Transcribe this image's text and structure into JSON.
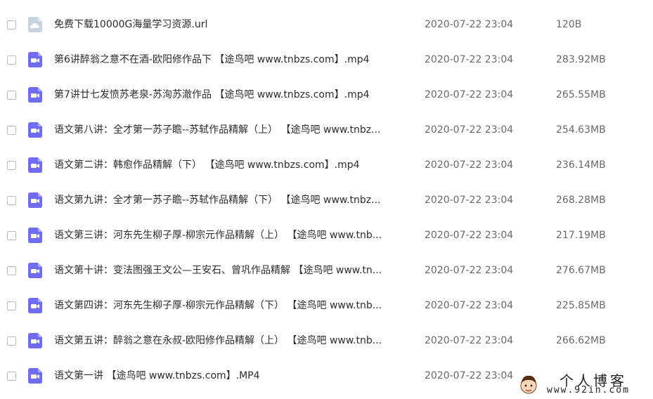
{
  "files": [
    {
      "type": "link",
      "icon": "url-file-icon",
      "name": "免费下载10000G海量学习资源.url",
      "date": "2020-07-22 23:04",
      "size": "120B"
    },
    {
      "type": "video",
      "icon": "video-file-icon",
      "name": "第6讲醉翁之意不在酒-欧阳修作品下 【途鸟吧 www.tnbzs.com】.mp4",
      "date": "2020-07-22 23:04",
      "size": "283.92MB"
    },
    {
      "type": "video",
      "icon": "video-file-icon",
      "name": "第7讲廿七发愤苏老泉-苏洵苏澈作品 【途鸟吧 www.tnbzs.com】.mp4",
      "date": "2020-07-22 23:04",
      "size": "265.55MB"
    },
    {
      "type": "video",
      "icon": "video-file-icon",
      "name": "语文第八讲：全才第一苏子瞻--苏轼作品精解（上） 【途鸟吧 www.tnbz...",
      "date": "2020-07-22 23:04",
      "size": "254.63MB"
    },
    {
      "type": "video",
      "icon": "video-file-icon",
      "name": "语文第二讲：韩愈作品精解（下） 【途鸟吧 www.tnbzs.com】.mp4",
      "date": "2020-07-22 23:04",
      "size": "236.14MB"
    },
    {
      "type": "video",
      "icon": "video-file-icon",
      "name": "语文第九讲：全才第一苏子瞻--苏轼作品精解（下） 【途鸟吧 www.tnbz...",
      "date": "2020-07-22 23:04",
      "size": "268.28MB"
    },
    {
      "type": "video",
      "icon": "video-file-icon",
      "name": "语文第三讲：河东先生柳子厚-柳宗元作品精解（上） 【途鸟吧 www.tnb...",
      "date": "2020-07-22 23:04",
      "size": "217.19MB"
    },
    {
      "type": "video",
      "icon": "video-file-icon",
      "name": "语文第十讲：变法图强王文公—王安石、曾巩作品精解 【途鸟吧 www.tn...",
      "date": "2020-07-22 23:04",
      "size": "276.67MB"
    },
    {
      "type": "video",
      "icon": "video-file-icon",
      "name": "语文第四讲：河东先生柳子厚-柳宗元作品精解（下） 【途鸟吧 www.tnb...",
      "date": "2020-07-22 23:04",
      "size": "225.85MB"
    },
    {
      "type": "video",
      "icon": "video-file-icon",
      "name": "语文第五讲：醉翁之意在永叔-欧阳修作品精解（上） 【途鸟吧 www.tnb...",
      "date": "2020-07-22 23:04",
      "size": "266.62MB"
    },
    {
      "type": "video",
      "icon": "video-file-icon",
      "name": "语文第一讲 【途鸟吧 www.tnbzs.com】.MP4",
      "date": "2020-07-22 23:04",
      "size": ""
    }
  ],
  "watermark": {
    "title": "个人博客",
    "url": "www.92in.com"
  },
  "colors": {
    "video_icon": "#6f6cf2",
    "link_icon": "#c9d3de"
  }
}
